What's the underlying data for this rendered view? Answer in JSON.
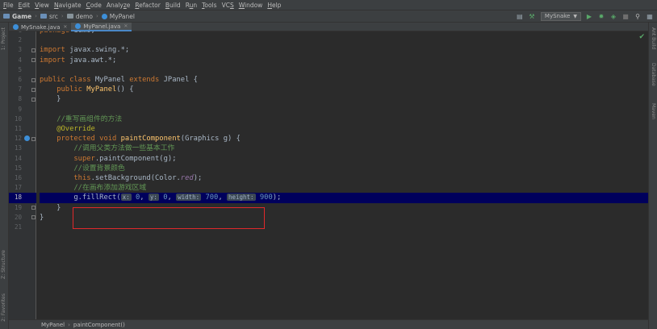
{
  "menu": [
    {
      "pre": "",
      "u": "F",
      "post": "ile"
    },
    {
      "pre": "",
      "u": "E",
      "post": "dit"
    },
    {
      "pre": "",
      "u": "V",
      "post": "iew"
    },
    {
      "pre": "",
      "u": "N",
      "post": "avigate"
    },
    {
      "pre": "",
      "u": "C",
      "post": "ode"
    },
    {
      "pre": "Analy",
      "u": "z",
      "post": "e"
    },
    {
      "pre": "",
      "u": "R",
      "post": "efactor"
    },
    {
      "pre": "",
      "u": "B",
      "post": "uild"
    },
    {
      "pre": "R",
      "u": "u",
      "post": "n"
    },
    {
      "pre": "",
      "u": "T",
      "post": "ools"
    },
    {
      "pre": "VC",
      "u": "S",
      "post": ""
    },
    {
      "pre": "",
      "u": "W",
      "post": "indow"
    },
    {
      "pre": "",
      "u": "H",
      "post": "elp"
    }
  ],
  "breadcrumb": {
    "project": "Game",
    "src": "src",
    "package": "demo",
    "file": "MyPanel"
  },
  "run_config": "MySnake",
  "tabs": [
    {
      "label": "MySnake.java",
      "active": false
    },
    {
      "label": "MyPanel.java",
      "active": true
    }
  ],
  "left_tools": [
    "1: Project",
    "Z: Structure",
    "2: Favorites"
  ],
  "right_tools": [
    "Ant Build",
    "Database",
    "Maven"
  ],
  "lines": [
    {
      "n": "1",
      "html": "<span class='kw'>package</span> demo;"
    },
    {
      "n": "2",
      "html": ""
    },
    {
      "n": "3",
      "html": "<span class='kw'>import</span> javax.swing.*;"
    },
    {
      "n": "4",
      "html": "<span class='kw'>import</span> java.awt.*;"
    },
    {
      "n": "5",
      "html": ""
    },
    {
      "n": "6",
      "html": "<span class='kw'>public class</span> MyPanel <span class='kw'>extends</span> JPanel {"
    },
    {
      "n": "7",
      "html": "    <span class='kw'>public</span> <span class='fn'>MyPanel</span>() {"
    },
    {
      "n": "8",
      "html": "    }"
    },
    {
      "n": "9",
      "html": ""
    },
    {
      "n": "10",
      "html": "    <span class='cm'>//重写画组件的方法</span>"
    },
    {
      "n": "11",
      "html": "    <span class='an'>@Override</span>"
    },
    {
      "n": "12",
      "html": "    <span class='kw'>protected void</span> <span class='fn'>paintComponent</span>(Graphics g) {"
    },
    {
      "n": "13",
      "html": "        <span class='cm'>//调用父类方法做一些基本工作</span>"
    },
    {
      "n": "14",
      "html": "        <span class='kw'>super</span>.paintComponent(g);"
    },
    {
      "n": "15",
      "html": "        <span class='cm'>//设置背景颜色</span>"
    },
    {
      "n": "16",
      "html": "        <span class='kw'>this</span>.setBackground(Color.<span class='it'>red</span>);"
    },
    {
      "n": "17",
      "html": "        <span class='cm'>//在画布添加游戏区域</span>"
    },
    {
      "n": "18",
      "html": "        g.fillRect(<span class='hint'>x:</span> <span class='num'>0</span>, <span class='hint'>y:</span> <span class='num'>0</span>, <span class='hint'>width:</span> <span class='num'>700</span>, <span class='hint'>height:</span> <span class='num'>900</span>);"
    },
    {
      "n": "19",
      "html": "    }"
    },
    {
      "n": "20",
      "html": "}"
    },
    {
      "n": "21",
      "html": ""
    }
  ],
  "status": {
    "crumb1": "MyPanel",
    "crumb2": "paintComponent()"
  },
  "colors": {
    "highlight_line": "#00005c",
    "annotation_box": "#e0282b"
  }
}
